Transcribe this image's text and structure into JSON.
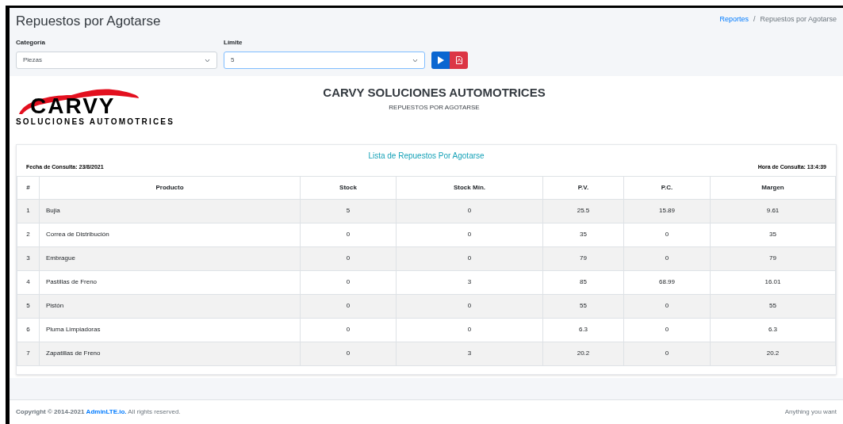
{
  "page_title": "Repuestos por Agotarse",
  "breadcrumb": [
    {
      "label": "Reportes",
      "kind": "link"
    },
    {
      "label": "/",
      "kind": "separator"
    },
    {
      "label": "Repuestos por Agotarse",
      "kind": "current"
    }
  ],
  "filters": [
    {
      "label": "Categoría",
      "value": "Piezas",
      "focused": false
    },
    {
      "label": "Límite",
      "value": "5",
      "focused": true
    }
  ],
  "report": {
    "logo_name": "CARVY",
    "logo_tagline": "SOLUCIONES AUTOMOTRICES",
    "company": "CARVY SOLUCIONES AUTOMOTRICES",
    "subtitle": "REPUESTOS POR AGOTARSE",
    "list_title": "Lista de Repuestos Por Agotarse",
    "date": "Fecha de Consulta: 23/8/2021",
    "time": "Hora de Consulta: 13:4:39",
    "table": {
      "columns": [
        "#",
        "Producto",
        "Stock",
        "Stock Mín.",
        "P.V.",
        "P.C.",
        "Margen"
      ],
      "rows": [
        [
          "1",
          "Bujia",
          "5",
          "0",
          "25.5",
          "15.89",
          "9.61"
        ],
        [
          "2",
          "Correa de Distribución",
          "0",
          "0",
          "35",
          "0",
          "35"
        ],
        [
          "3",
          "Embrague",
          "0",
          "0",
          "79",
          "0",
          "79"
        ],
        [
          "4",
          "Pastillas de Freno",
          "0",
          "3",
          "85",
          "68.99",
          "16.01"
        ],
        [
          "5",
          "Pistón",
          "0",
          "0",
          "55",
          "0",
          "55"
        ],
        [
          "6",
          "Pluma Limpiadoras",
          "0",
          "0",
          "6.3",
          "0",
          "6.3"
        ],
        [
          "7",
          "Zapatillas de Freno",
          "0",
          "3",
          "20.2",
          "0",
          "20.2"
        ]
      ]
    }
  },
  "footer": {
    "copyright": "Copyright © 2014-2021",
    "link": "AdminLTE.io.",
    "rights": "All rights reserved.",
    "right_text": "Anything you want"
  }
}
